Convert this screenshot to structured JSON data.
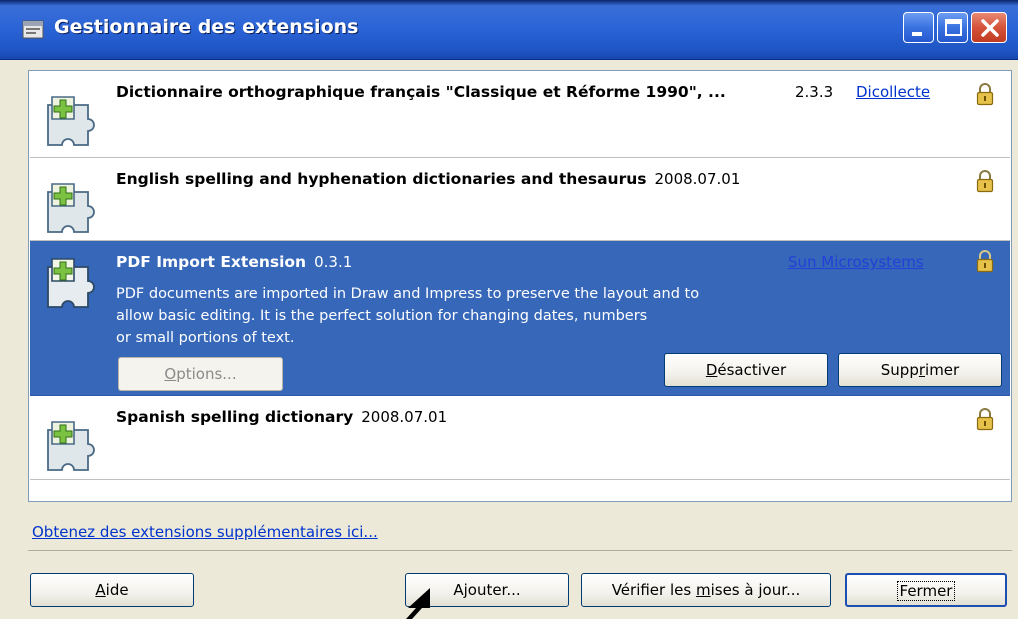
{
  "window": {
    "title": "Gestionnaire des extensions",
    "minimize_icon": "minimize-icon",
    "maximize_icon": "maximize-icon",
    "close_icon": "close-icon"
  },
  "extensions": [
    {
      "name": "Dictionnaire orthographique français \"Classique et Réforme 1990\", ...",
      "version": "2.3.3",
      "publisher": "Dicollecte",
      "icon": "puzzle-extension-icon",
      "locked": true,
      "selected": false
    },
    {
      "name": "English spelling and hyphenation dictionaries and thesaurus",
      "version": "2008.07.01",
      "publisher": "",
      "icon": "puzzle-extension-icon",
      "locked": true,
      "selected": false
    },
    {
      "name": "PDF Import Extension",
      "version": "0.3.1",
      "publisher": "Sun Microsystems",
      "description": "PDF documents are imported in Draw and Impress to preserve the layout and to allow basic editing. It is the perfect solution for changing dates, numbers or small portions of text.",
      "description_lines": [
        "PDF documents are imported in Draw and Impress to preserve the layout and to",
        "allow basic editing. It is the perfect solution for changing dates, numbers",
        "or small portions of text."
      ],
      "icon": "puzzle-extension-icon",
      "locked": true,
      "selected": true,
      "buttons": {
        "options": "Options...",
        "options_accel": "O",
        "options_rest": "ptions...",
        "disable": "Désactiver",
        "disable_accel": "D",
        "disable_rest": "ésactiver",
        "remove": "Supprimer",
        "remove_pre": "Supp",
        "remove_accel": "r",
        "remove_rest": "imer"
      }
    },
    {
      "name": "Spanish spelling dictionary",
      "version": "2008.07.01",
      "publisher": "",
      "icon": "puzzle-extension-icon",
      "locked": true,
      "selected": false
    }
  ],
  "more_extensions_link": "Obtenez des extensions supplémentaires ici...",
  "footer": {
    "help": "Aide",
    "help_accel": "A",
    "help_rest": "ide",
    "add": "Ajouter...",
    "add_pre": "A",
    "add_accel": "j",
    "add_rest": "outer...",
    "check_updates": "Vérifier les mises à jour...",
    "check_pre": "Vérifier les ",
    "check_accel": "m",
    "check_rest": "ises à jour...",
    "close": "Fermer"
  },
  "colors": {
    "selection": "#3667b8",
    "titlebar": "#2a63d6",
    "link": "#0033cc",
    "window_bg": "#ece9d8"
  }
}
